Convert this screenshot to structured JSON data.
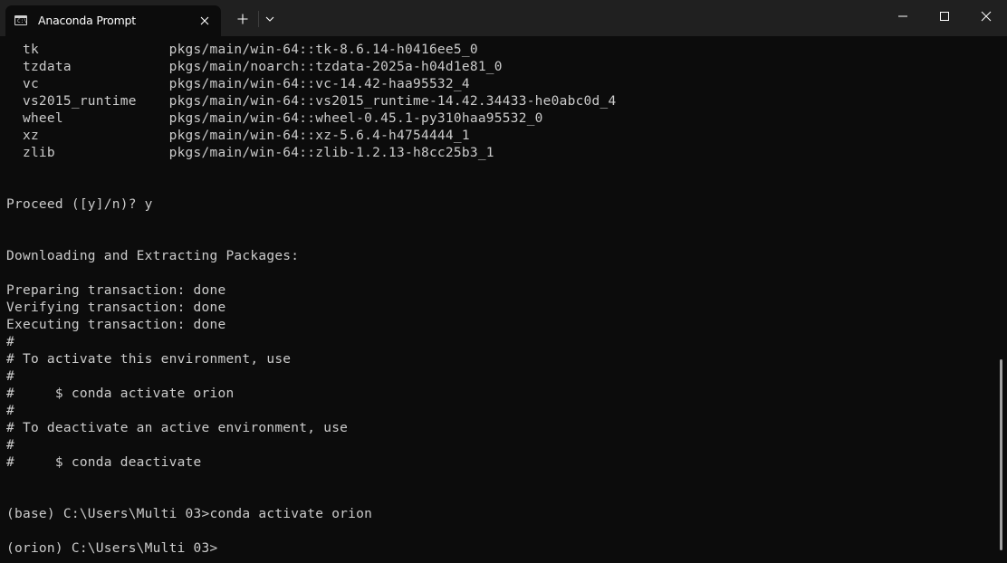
{
  "window": {
    "tab_title": "Anaconda Prompt",
    "icons": {
      "tab": "terminal-icon",
      "tab_close": "close-icon",
      "new_tab": "plus-icon",
      "dropdown": "chevron-down-icon",
      "minimize": "minimize-icon",
      "maximize": "maximize-icon",
      "close": "close-icon"
    }
  },
  "terminal": {
    "lines": [
      "  tk                pkgs/main/win-64::tk-8.6.14-h0416ee5_0",
      "  tzdata            pkgs/main/noarch::tzdata-2025a-h04d1e81_0",
      "  vc                pkgs/main/win-64::vc-14.42-haa95532_4",
      "  vs2015_runtime    pkgs/main/win-64::vs2015_runtime-14.42.34433-he0abc0d_4",
      "  wheel             pkgs/main/win-64::wheel-0.45.1-py310haa95532_0",
      "  xz                pkgs/main/win-64::xz-5.6.4-h4754444_1",
      "  zlib              pkgs/main/win-64::zlib-1.2.13-h8cc25b3_1",
      "",
      "",
      "Proceed ([y]/n)? y",
      "",
      "",
      "Downloading and Extracting Packages:",
      "",
      "Preparing transaction: done",
      "Verifying transaction: done",
      "Executing transaction: done",
      "#",
      "# To activate this environment, use",
      "#",
      "#     $ conda activate orion",
      "#",
      "# To deactivate an active environment, use",
      "#",
      "#     $ conda deactivate",
      "",
      "",
      "(base) C:\\Users\\Multi 03>conda activate orion",
      "",
      "(orion) C:\\Users\\Multi 03>"
    ]
  },
  "colors": {
    "terminal_bg": "#0c0c0c",
    "terminal_fg": "#cccccc",
    "titlebar_bg": "#202020",
    "scrollbar": "#a0a0a0"
  }
}
